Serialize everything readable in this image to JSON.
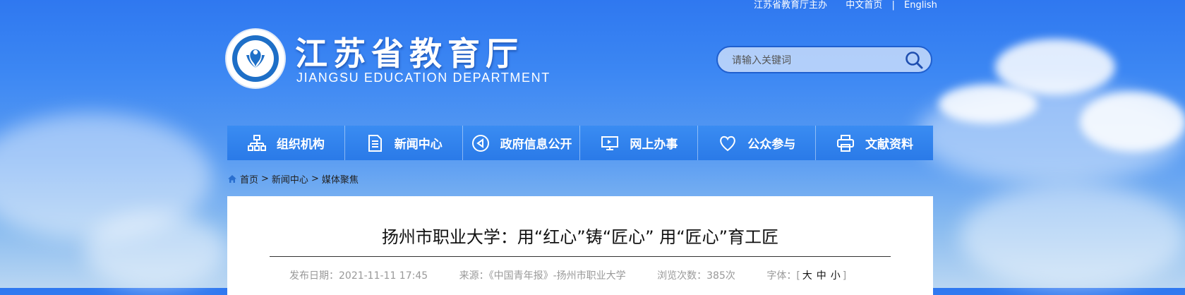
{
  "top_links": {
    "sponsor": "江苏省教育厅主办",
    "home": "中文首页",
    "english": "English"
  },
  "header": {
    "title": "江苏省教育厅",
    "subtitle": "JIANGSU EDUCATION DEPARTMENT"
  },
  "search": {
    "placeholder": "请输入关键词"
  },
  "nav": {
    "items": [
      {
        "label": "组织机构",
        "icon": "org-chart-icon"
      },
      {
        "label": "新闻中心",
        "icon": "document-icon"
      },
      {
        "label": "政府信息公开",
        "icon": "megaphone-icon"
      },
      {
        "label": "网上办事",
        "icon": "monitor-icon"
      },
      {
        "label": "公众参与",
        "icon": "heart-icon"
      },
      {
        "label": "文献资料",
        "icon": "printer-icon"
      }
    ]
  },
  "breadcrumb": {
    "home": "首页",
    "sep1": ">",
    "news": "新闻中心",
    "sep2": ">",
    "current": "媒体聚焦"
  },
  "article": {
    "title": "扬州市职业大学：用“红心”铸“匠心” 用“匠心”育工匠",
    "publish_label": "发布日期：",
    "publish_date": "2021-11-11 17:45",
    "source_label": "来源：",
    "source": "《中国青年报》-扬州市职业大学",
    "views_label": "浏览次数：",
    "views": "385次",
    "font_label": "字体：",
    "font_open": "[",
    "font_large": "大",
    "font_medium": "中",
    "font_small": "小",
    "font_close": "]"
  }
}
